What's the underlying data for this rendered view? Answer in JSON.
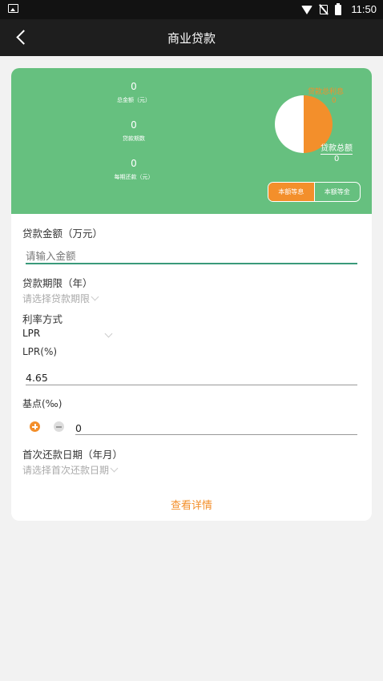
{
  "status_bar": {
    "time": "11:50"
  },
  "app_bar": {
    "title": "商业贷款"
  },
  "summary": {
    "stats": [
      {
        "value": "0",
        "label": "总金额（元）"
      },
      {
        "value": "0",
        "label": "贷款期数"
      },
      {
        "value": "0",
        "label": "每期还款（元）"
      }
    ],
    "pie_label": "贷款总利息",
    "pie_value": "0",
    "total_label": "贷款总额",
    "total_value": "0",
    "toggle": {
      "options": [
        "本额等息",
        "本额等金"
      ],
      "selected": "本额等息"
    },
    "colors": {
      "background": "#66c07f",
      "accent": "#f38f2b"
    }
  },
  "form": {
    "amount": {
      "label": "贷款金额（万元）",
      "placeholder": "请输入金额",
      "value": ""
    },
    "term": {
      "label": "贷款期限（年）",
      "placeholder": "请选择贷款期限"
    },
    "rate_mode": {
      "label": "利率方式",
      "value": "LPR"
    },
    "lpr": {
      "label": "LPR(%)",
      "value": "4.65"
    },
    "basis": {
      "label": "基点(‰)",
      "value": "0"
    },
    "first_repay": {
      "label": "首次还款日期（年月）",
      "placeholder": "请选择首次还款日期"
    }
  },
  "detail_button": "查看详情"
}
